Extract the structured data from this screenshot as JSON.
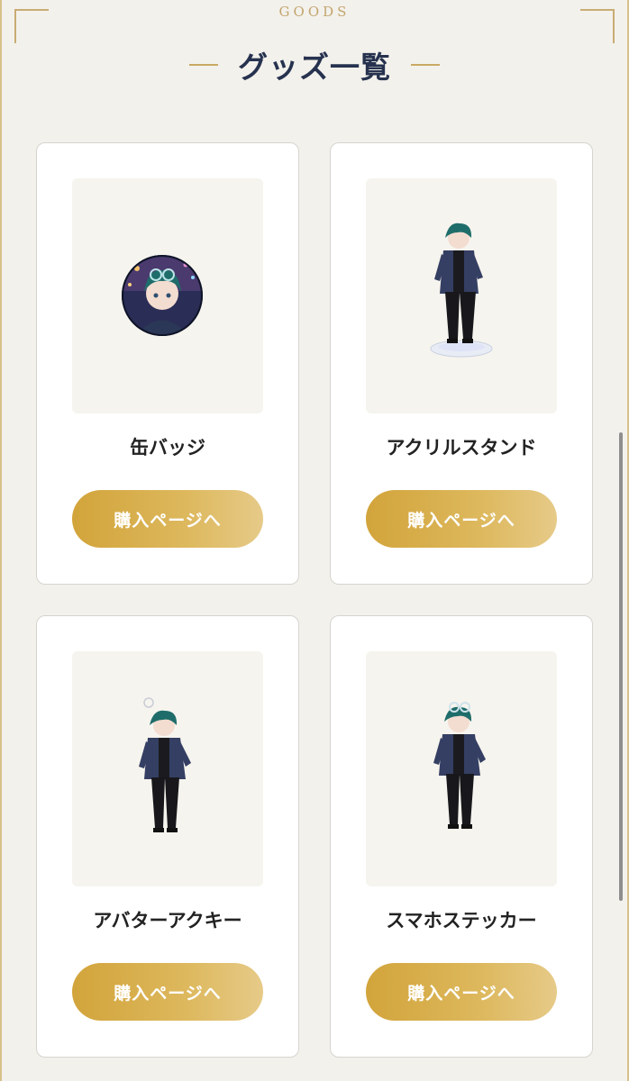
{
  "section": {
    "eyebrow": "GOODS",
    "title": "グッズ一覧"
  },
  "items": [
    {
      "name": "缶バッジ",
      "button_label": "購入ページへ",
      "image_icon": "can-badge-image"
    },
    {
      "name": "アクリルスタンド",
      "button_label": "購入ページへ",
      "image_icon": "acrylic-stand-image"
    },
    {
      "name": "アバターアクキー",
      "button_label": "購入ページへ",
      "image_icon": "acrylic-keychain-image"
    },
    {
      "name": "スマホステッカー",
      "button_label": "購入ページへ",
      "image_icon": "phone-sticker-image"
    }
  ],
  "colors": {
    "accent_gold": "#d2a43b",
    "title_navy": "#26324e",
    "page_background": "#f3f1ec"
  }
}
